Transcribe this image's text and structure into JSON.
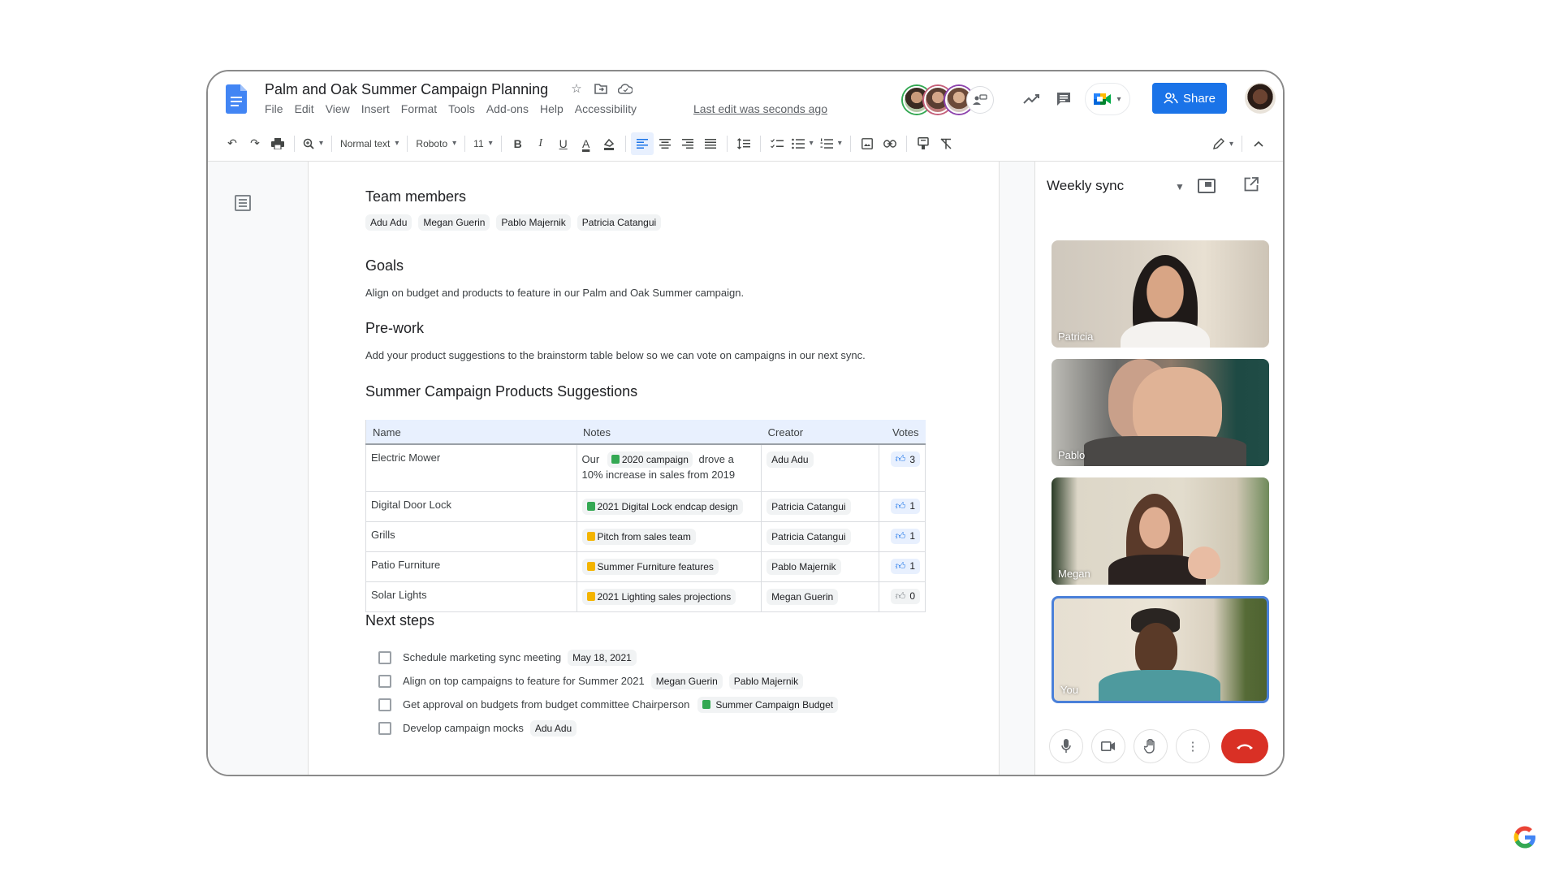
{
  "header": {
    "doc_title": "Palm and Oak Summer Campaign Planning",
    "menu": [
      "File",
      "Edit",
      "View",
      "Insert",
      "Format",
      "Tools",
      "Add-ons",
      "Help",
      "Accessibility"
    ],
    "last_edit": "Last edit was seconds ago",
    "share_label": "Share",
    "collaborators_count_icon": "present-to-all-icon"
  },
  "toolbar": {
    "zoom": "",
    "style": "Normal text",
    "font": "Roboto",
    "font_size": "11",
    "bold": "B",
    "italic": "I",
    "underline": "U",
    "text_color": "A"
  },
  "doc": {
    "team_heading": "Team members",
    "team": [
      "Adu Adu",
      "Megan Guerin",
      "Pablo Majernik",
      "Patricia Catangui"
    ],
    "goals_heading": "Goals",
    "goals_text": "Align on budget and products to feature in our Palm and Oak Summer campaign.",
    "prework_heading": "Pre-work",
    "prework_text": "Add your product suggestions to the brainstorm table below so we can vote on campaigns in our next sync.",
    "table_heading": "Summer Campaign Products Suggestions",
    "table": {
      "headers": [
        "Name",
        "Notes",
        "Creator",
        "Votes"
      ],
      "rows": [
        {
          "name": "Electric Mower",
          "note_prefix": "Our",
          "note_chip": "2020 campaign",
          "note_chip_type": "sheet",
          "note_suffix": "drove a 10% increase in sales from 2019",
          "creator": "Adu Adu",
          "votes": "3"
        },
        {
          "name": "Digital Door Lock",
          "note_prefix": "",
          "note_chip": "2021 Digital Lock endcap design",
          "note_chip_type": "sheet",
          "note_suffix": "",
          "creator": "Patricia Catangui",
          "votes": "1"
        },
        {
          "name": "Grills",
          "note_prefix": "",
          "note_chip": "Pitch from sales team",
          "note_chip_type": "slide",
          "note_suffix": "",
          "creator": "Patricia Catangui",
          "votes": "1"
        },
        {
          "name": "Patio Furniture",
          "note_prefix": "",
          "note_chip": "Summer Furniture features",
          "note_chip_type": "slide",
          "note_suffix": "",
          "creator": "Pablo Majernik",
          "votes": "1"
        },
        {
          "name": "Solar Lights",
          "note_prefix": "",
          "note_chip": "2021 Lighting sales projections",
          "note_chip_type": "slide",
          "note_suffix": "",
          "creator": "Megan Guerin",
          "votes": "0"
        }
      ]
    },
    "next_heading": "Next steps",
    "steps": [
      {
        "text": "Schedule marketing sync meeting",
        "chips": [
          "May 18, 2021"
        ],
        "checked": false
      },
      {
        "text": "Align on top campaigns to feature for Summer 2021",
        "chips": [
          "Megan Guerin",
          "Pablo Majernik"
        ],
        "checked": false
      },
      {
        "text": "Get approval on budgets from budget committee Chairperson",
        "chips": [
          "Summer Campaign Budget"
        ],
        "chip_type": "sheet",
        "checked": false
      },
      {
        "text": "Develop campaign mocks",
        "chips": [
          "Adu Adu"
        ],
        "checked": false
      }
    ]
  },
  "meet": {
    "title": "Weekly sync",
    "participants": [
      "Patricia",
      "Pablo",
      "Megan",
      "You"
    ],
    "active_speaker_highlight": "#4a80d9",
    "end_call_color": "#d93025"
  },
  "colors": {
    "accent": "#1a73e8",
    "sheet_green": "#34a853",
    "slide_yellow": "#f4b400"
  }
}
